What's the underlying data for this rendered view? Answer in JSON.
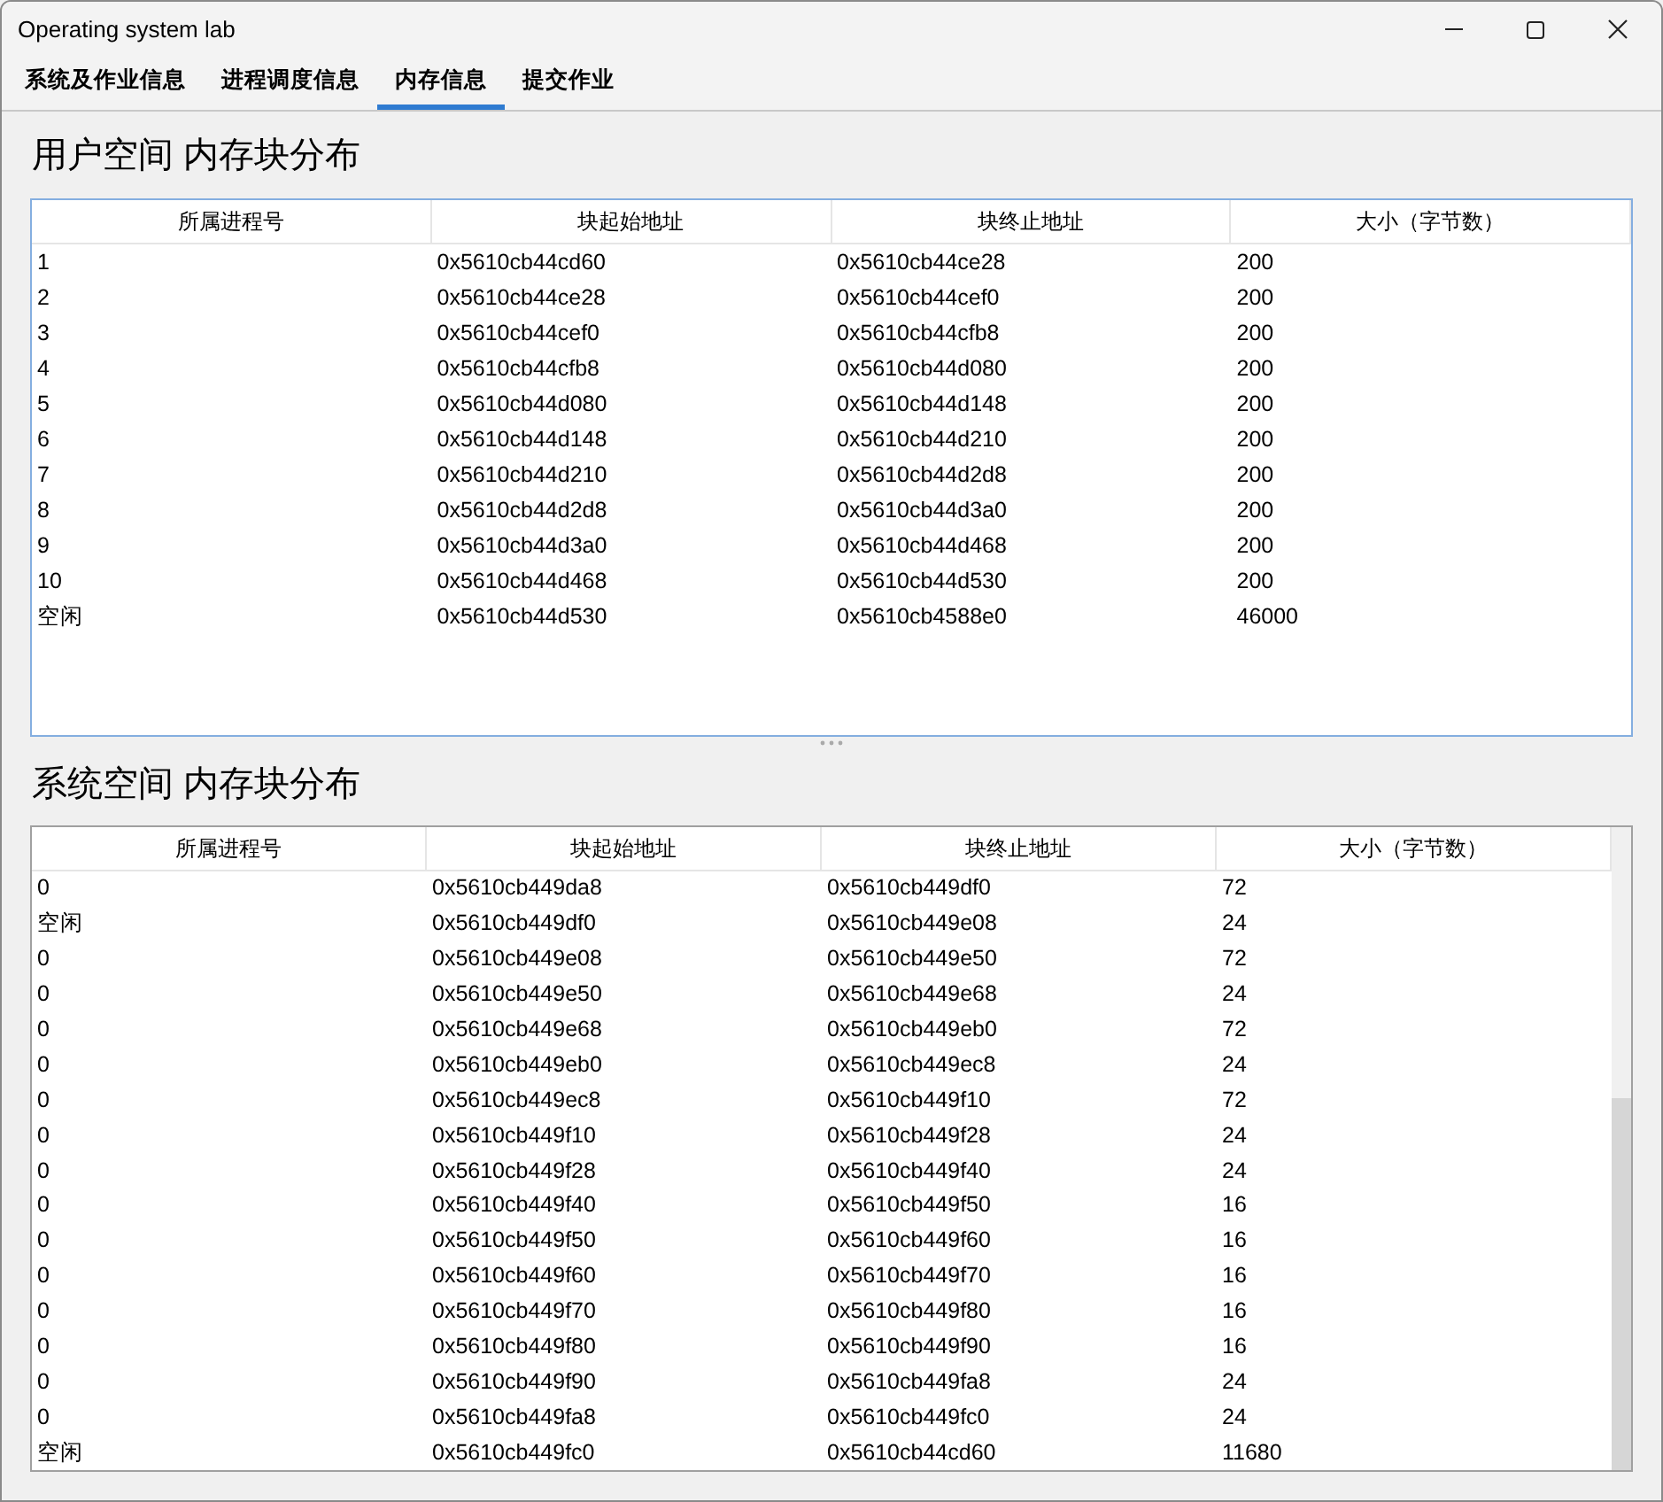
{
  "window": {
    "title": "Operating system lab"
  },
  "tabs": [
    {
      "label": "系统及作业信息",
      "selected": false
    },
    {
      "label": "进程调度信息",
      "selected": false
    },
    {
      "label": "内存信息",
      "selected": true
    },
    {
      "label": "提交作业",
      "selected": false
    }
  ],
  "sections": [
    {
      "heading": "用户空间 内存块分布",
      "table": {
        "columns": [
          "所属进程号",
          "块起始地址",
          "块终止地址",
          "大小（字节数）"
        ],
        "rows": [
          [
            "1",
            "0x5610cb44cd60",
            "0x5610cb44ce28",
            "200"
          ],
          [
            "2",
            "0x5610cb44ce28",
            "0x5610cb44cef0",
            "200"
          ],
          [
            "3",
            "0x5610cb44cef0",
            "0x5610cb44cfb8",
            "200"
          ],
          [
            "4",
            "0x5610cb44cfb8",
            "0x5610cb44d080",
            "200"
          ],
          [
            "5",
            "0x5610cb44d080",
            "0x5610cb44d148",
            "200"
          ],
          [
            "6",
            "0x5610cb44d148",
            "0x5610cb44d210",
            "200"
          ],
          [
            "7",
            "0x5610cb44d210",
            "0x5610cb44d2d8",
            "200"
          ],
          [
            "8",
            "0x5610cb44d2d8",
            "0x5610cb44d3a0",
            "200"
          ],
          [
            "9",
            "0x5610cb44d3a0",
            "0x5610cb44d468",
            "200"
          ],
          [
            "10",
            "0x5610cb44d468",
            "0x5610cb44d530",
            "200"
          ],
          [
            "空闲",
            "0x5610cb44d530",
            "0x5610cb4588e0",
            "46000"
          ]
        ]
      }
    },
    {
      "heading": "系统空间 内存块分布",
      "table": {
        "columns": [
          "所属进程号",
          "块起始地址",
          "块终止地址",
          "大小（字节数）"
        ],
        "scrollbar": true,
        "rows": [
          [
            "0",
            "0x5610cb449da8",
            "0x5610cb449df0",
            "72"
          ],
          [
            "空闲",
            "0x5610cb449df0",
            "0x5610cb449e08",
            "24"
          ],
          [
            "0",
            "0x5610cb449e08",
            "0x5610cb449e50",
            "72"
          ],
          [
            "0",
            "0x5610cb449e50",
            "0x5610cb449e68",
            "24"
          ],
          [
            "0",
            "0x5610cb449e68",
            "0x5610cb449eb0",
            "72"
          ],
          [
            "0",
            "0x5610cb449eb0",
            "0x5610cb449ec8",
            "24"
          ],
          [
            "0",
            "0x5610cb449ec8",
            "0x5610cb449f10",
            "72"
          ],
          [
            "0",
            "0x5610cb449f10",
            "0x5610cb449f28",
            "24"
          ],
          [
            "0",
            "0x5610cb449f28",
            "0x5610cb449f40",
            "24"
          ],
          [
            "0",
            "0x5610cb449f40",
            "0x5610cb449f50",
            "16"
          ],
          [
            "0",
            "0x5610cb449f50",
            "0x5610cb449f60",
            "16"
          ],
          [
            "0",
            "0x5610cb449f60",
            "0x5610cb449f70",
            "16"
          ],
          [
            "0",
            "0x5610cb449f70",
            "0x5610cb449f80",
            "16"
          ],
          [
            "0",
            "0x5610cb449f80",
            "0x5610cb449f90",
            "16"
          ],
          [
            "0",
            "0x5610cb449f90",
            "0x5610cb449fa8",
            "24"
          ],
          [
            "0",
            "0x5610cb449fa8",
            "0x5610cb449fc0",
            "24"
          ],
          [
            "空闲",
            "0x5610cb449fc0",
            "0x5610cb44cd60",
            "11680"
          ]
        ]
      }
    }
  ]
}
